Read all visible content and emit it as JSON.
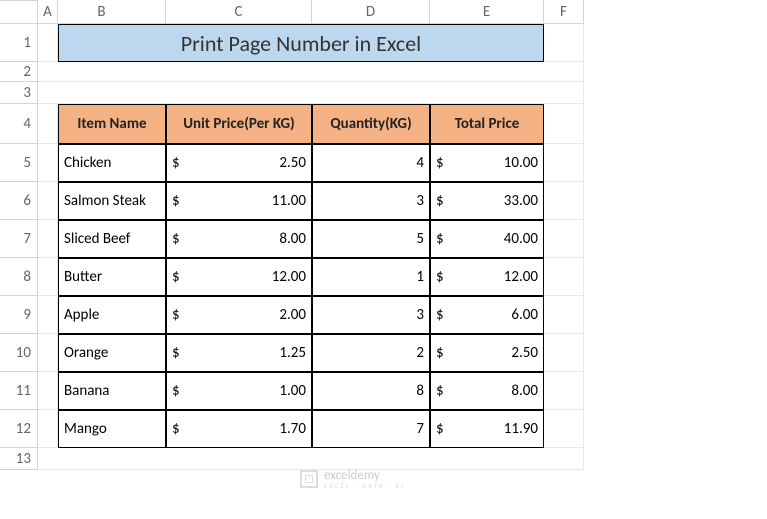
{
  "columns": [
    "A",
    "B",
    "C",
    "D",
    "E",
    "F"
  ],
  "rows": [
    "1",
    "2",
    "3",
    "4",
    "5",
    "6",
    "7",
    "8",
    "9",
    "10",
    "11",
    "12",
    "13"
  ],
  "title": "Print Page Number in Excel",
  "headers": {
    "item": "Item Name",
    "unit": "Unit Price(Per KG)",
    "qty": "Quantity(KG)",
    "total": "Total Price"
  },
  "currency": "$",
  "items": [
    {
      "name": "Chicken",
      "unit": "2.50",
      "qty": "4",
      "total": "10.00"
    },
    {
      "name": "Salmon Steak",
      "unit": "11.00",
      "qty": "3",
      "total": "33.00"
    },
    {
      "name": "Sliced Beef",
      "unit": "8.00",
      "qty": "5",
      "total": "40.00"
    },
    {
      "name": "Butter",
      "unit": "12.00",
      "qty": "1",
      "total": "12.00"
    },
    {
      "name": "Apple",
      "unit": "2.00",
      "qty": "3",
      "total": "6.00"
    },
    {
      "name": "Orange",
      "unit": "1.25",
      "qty": "2",
      "total": "2.50"
    },
    {
      "name": "Banana",
      "unit": "1.00",
      "qty": "8",
      "total": "8.00"
    },
    {
      "name": "Mango",
      "unit": "1.70",
      "qty": "7",
      "total": "11.90"
    }
  ],
  "watermark": {
    "name": "exceldemy",
    "sub": "EXCEL · DATA · BI"
  },
  "chart_data": {
    "type": "table",
    "title": "Print Page Number in Excel",
    "columns": [
      "Item Name",
      "Unit Price(Per KG)",
      "Quantity(KG)",
      "Total Price"
    ],
    "rows": [
      [
        "Chicken",
        2.5,
        4,
        10.0
      ],
      [
        "Salmon Steak",
        11.0,
        3,
        33.0
      ],
      [
        "Sliced Beef",
        8.0,
        5,
        40.0
      ],
      [
        "Butter",
        12.0,
        1,
        12.0
      ],
      [
        "Apple",
        2.0,
        3,
        6.0
      ],
      [
        "Orange",
        1.25,
        2,
        2.5
      ],
      [
        "Banana",
        1.0,
        8,
        8.0
      ],
      [
        "Mango",
        1.7,
        7,
        11.9
      ]
    ]
  }
}
